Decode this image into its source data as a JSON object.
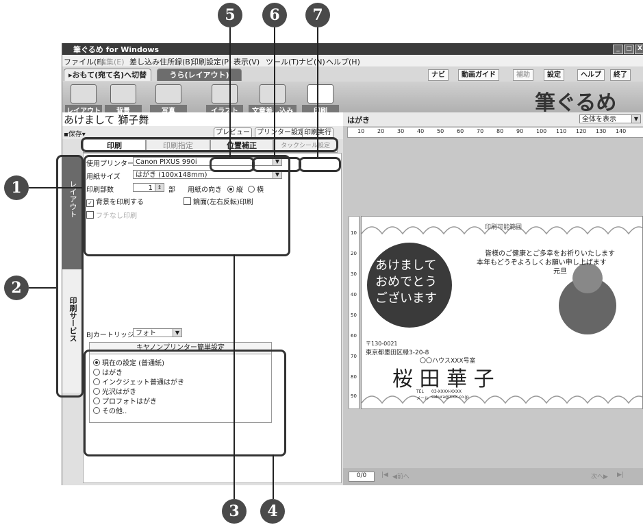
{
  "callouts": [
    "1",
    "2",
    "3",
    "4",
    "5",
    "6",
    "7"
  ],
  "window": {
    "title": "筆ぐるめ for Windows",
    "controls": {
      "minimize": "_",
      "restore": "□",
      "close": "X"
    }
  },
  "menu": [
    "ファイル(F)",
    "編集(E)",
    "差し込み住所録(B)",
    "印刷設定(P)",
    "表示(V)",
    "ツール(T)",
    "ナビ(N)",
    "ヘルプ(H)"
  ],
  "tabs": {
    "front": "▸おもて(宛て名)へ切替",
    "back": "うら(レイアウト)"
  },
  "right_buttons": [
    "ナビ",
    "動画ガイド",
    "補助",
    "設定",
    "ヘルプ",
    "終了"
  ],
  "toolbar": [
    "レイアウト",
    "背景",
    "写真",
    "イラスト",
    "文章差し込み",
    "印刷"
  ],
  "logo": "筆ぐるめ",
  "document": {
    "title": "あけまして 獅子舞",
    "save": "保存"
  },
  "action_buttons": {
    "preview": "プレビュー",
    "printer_setting": "プリンター設定",
    "print_exec": "印刷実行"
  },
  "panel_tabs": [
    "印刷",
    "印刷指定",
    "位置補正",
    "タックシール設定"
  ],
  "side_tabs": {
    "layout": "レイアウト",
    "print_service": "印刷サービス"
  },
  "settings": {
    "printer_label": "使用プリンター",
    "printer_value": "Canon PIXUS 990i",
    "paper_label": "用紙サイズ",
    "paper_value": "はがき (100x148mm)",
    "copies_label": "印刷部数",
    "copies_value": "1",
    "copies_unit": "部",
    "orientation_label": "用紙の向き",
    "orient_portrait": "縦",
    "orient_landscape": "横",
    "bg_print": "背景を印刷する",
    "mirror_print": "鏡面(左右反転)印刷",
    "borderless": "フチなし印刷"
  },
  "cartridge": {
    "label": "BJカートリッジ",
    "value": "フォト",
    "header": "キヤノンプリンター簡単設定",
    "options": [
      "現在の設定 (普通紙)",
      "はがき",
      "インクジェット普通はがき",
      "光沢はがき",
      "プロフォトはがき",
      "その他.."
    ]
  },
  "preview": {
    "label": "はがき",
    "zoom": "全体を表示",
    "ruler": [
      "10",
      "20",
      "30",
      "40",
      "50",
      "60",
      "70",
      "80",
      "90",
      "100",
      "110",
      "120",
      "130",
      "140"
    ],
    "scale": [
      "10",
      "20",
      "30",
      "40",
      "50",
      "60",
      "70",
      "80",
      "90"
    ],
    "area_label": "印刷可能範囲",
    "greeting": "あけましておめでとうございます",
    "message": [
      "皆様のご健康とご多幸をお祈りいたします",
      "本年もどうぞよろしくお願い申し上げます",
      "元旦"
    ],
    "postal": "〒130-0021",
    "address": "東京都墨田区緑3-20-8",
    "building": "〇〇ハウスXXX号室",
    "name": "桜 田 華 子",
    "tel_label": "TEL",
    "tel": "03-XXXX-XXXX",
    "mail_label": "メール",
    "mail": "sakura@XXX.co.jp",
    "page": "0/0",
    "prev": "前へ",
    "next": "次へ"
  }
}
